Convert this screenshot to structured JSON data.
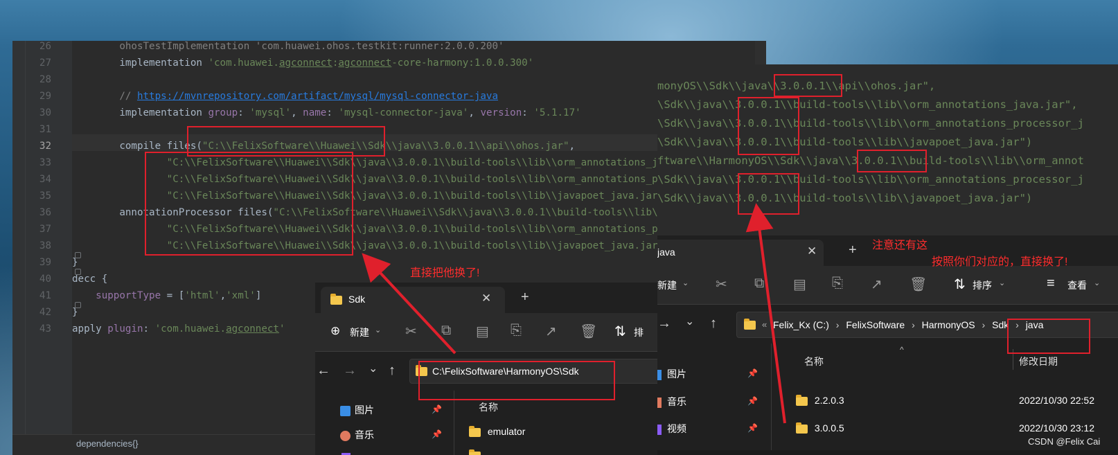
{
  "editor": {
    "lines": [
      {
        "num": "26",
        "segs": [
          {
            "t": "        ohosTestImplementation 'com.huawei.ohos.testkit:runner:2.0.0.200'",
            "c": "cmt"
          }
        ]
      },
      {
        "num": "27",
        "segs": [
          {
            "t": "        implementation ",
            "c": ""
          },
          {
            "t": "'com.huawei.",
            "c": "str"
          },
          {
            "t": "agconnect",
            "c": "str ul"
          },
          {
            "t": ":",
            "c": "str"
          },
          {
            "t": "agconnect",
            "c": "str ul"
          },
          {
            "t": "-core-harmony:1.0.0.300'",
            "c": "str"
          }
        ]
      },
      {
        "num": "28",
        "segs": []
      },
      {
        "num": "29",
        "segs": [
          {
            "t": "        // ",
            "c": "cmt"
          },
          {
            "t": "https://mvnrepository.com/artifact/mysql/mysql-connector-java",
            "c": "url"
          }
        ]
      },
      {
        "num": "30",
        "segs": [
          {
            "t": "        implementation ",
            "c": ""
          },
          {
            "t": "group",
            "c": "nm"
          },
          {
            "t": ": ",
            "c": ""
          },
          {
            "t": "'mysql'",
            "c": "str"
          },
          {
            "t": ", ",
            "c": ""
          },
          {
            "t": "name",
            "c": "nm"
          },
          {
            "t": ": ",
            "c": ""
          },
          {
            "t": "'mysql-connector-java'",
            "c": "str"
          },
          {
            "t": ", ",
            "c": ""
          },
          {
            "t": "version",
            "c": "nm"
          },
          {
            "t": ": ",
            "c": ""
          },
          {
            "t": "'5.1.17'",
            "c": "str"
          }
        ]
      },
      {
        "num": "31",
        "segs": []
      },
      {
        "num": "32",
        "cur": true,
        "segs": [
          {
            "t": "        compile files(",
            "c": ""
          },
          {
            "t": "\"C:\\\\FelixSoftware\\\\Huawei\\\\Sdk\\\\java\\\\3.0.0.1\\\\api\\\\ohos.jar\"",
            "c": "str"
          },
          {
            "t": ",",
            "c": ""
          }
        ]
      },
      {
        "num": "33",
        "segs": [
          {
            "t": "                \"C:\\\\FelixSoftware\\\\Huawei\\\\Sdk\\\\java\\\\3.0.0.1\\\\build-tools\\\\lib\\\\orm_annotations_java.jar\",",
            "c": "str"
          }
        ]
      },
      {
        "num": "34",
        "segs": [
          {
            "t": "                \"C:\\\\FelixSoftware\\\\Huawei\\\\Sdk\\\\java\\\\3.0.0.1\\\\build-tools\\\\lib\\\\orm_annotations_processor_java.jar\",",
            "c": "str"
          }
        ]
      },
      {
        "num": "35",
        "segs": [
          {
            "t": "                \"C:\\\\FelixSoftware\\\\Huawei\\\\Sdk\\\\java\\\\3.0.0.1\\\\build-tools\\\\lib\\\\javapoet_java.jar\")",
            "c": "str"
          }
        ]
      },
      {
        "num": "36",
        "segs": [
          {
            "t": "        annotationProcessor files(",
            "c": ""
          },
          {
            "t": "\"C:\\\\FelixSoftware\\\\Huawei\\\\Sdk\\\\java\\\\3.0.0.1\\\\build-tools\\\\lib\\\\orm_annotations_java.jar\",",
            "c": "str"
          }
        ]
      },
      {
        "num": "37",
        "segs": [
          {
            "t": "                \"C:\\\\FelixSoftware\\\\Huawei\\\\Sdk\\\\java\\\\3.0.0.1\\\\build-tools\\\\lib\\\\orm_annotations_processor_java.jar\",",
            "c": "str"
          }
        ]
      },
      {
        "num": "38",
        "segs": [
          {
            "t": "                \"C:\\\\FelixSoftware\\\\Huawei\\\\Sdk\\\\java\\\\3.0.0.1\\\\build-tools\\\\lib\\\\javapoet_java.jar\")",
            "c": "str"
          }
        ]
      },
      {
        "num": "39",
        "segs": [
          {
            "t": "}",
            "c": ""
          }
        ]
      },
      {
        "num": "40",
        "segs": [
          {
            "t": "decc {",
            "c": ""
          }
        ]
      },
      {
        "num": "41",
        "segs": [
          {
            "t": "    ",
            "c": ""
          },
          {
            "t": "supportType",
            "c": "nm"
          },
          {
            "t": " = [",
            "c": ""
          },
          {
            "t": "'html'",
            "c": "str"
          },
          {
            "t": ",",
            "c": ""
          },
          {
            "t": "'xml'",
            "c": "str"
          },
          {
            "t": "]",
            "c": ""
          }
        ]
      },
      {
        "num": "42",
        "segs": [
          {
            "t": "}",
            "c": ""
          }
        ]
      },
      {
        "num": "43",
        "segs": [
          {
            "t": "apply ",
            "c": ""
          },
          {
            "t": "plugin",
            "c": "nm"
          },
          {
            "t": ": ",
            "c": ""
          },
          {
            "t": "'com.huawei.",
            "c": "str"
          },
          {
            "t": "agconnect",
            "c": "str ul"
          },
          {
            "t": "'",
            "c": "str"
          }
        ]
      }
    ],
    "footer": "dependencies{}"
  },
  "zoom": {
    "lines": [
      "monyOS\\\\Sdk\\\\java\\\\3.0.0.1\\\\api\\\\ohos.jar\",",
      "\\Sdk\\\\java\\\\3.0.0.1\\\\build-tools\\\\lib\\\\orm_annotations_java.jar\",",
      "\\Sdk\\\\java\\\\3.0.0.1\\\\build-tools\\\\lib\\\\orm_annotations_processor_j",
      "\\Sdk\\\\java\\\\3.0.0.1\\\\build-tools\\\\lib\\\\javapoet_java.jar\")",
      "ftware\\\\HarmonyOS\\\\Sdk\\\\java\\\\3.0.0.1\\\\build-tools\\\\lib\\\\orm_annot",
      "\\Sdk\\\\java\\\\3.0.0.1\\\\build-tools\\\\lib\\\\orm_annotations_processor_j",
      "\\Sdk\\\\java\\\\3.0.0.1\\\\build-tools\\\\lib\\\\javapoet_java.jar\")"
    ]
  },
  "annotations": {
    "replace_note": "直接把他换了!",
    "also_note": "注意还有这",
    "match_note": "按照你们对应的，直接换了!"
  },
  "explorer_left": {
    "tab_title": "Sdk",
    "new_label": "新建",
    "sort_partial": "排",
    "address": "C:\\FelixSoftware\\HarmonyOS\\Sdk",
    "sidebar": [
      {
        "label": "图片",
        "icon": "pictures-icon"
      },
      {
        "label": "音乐",
        "icon": "music-icon"
      }
    ],
    "column_name": "名称",
    "rows": [
      "emulator"
    ]
  },
  "explorer_right": {
    "tab_title": "java",
    "new_label": "新建",
    "sort_label": "排序",
    "view_label": "查看",
    "breadcrumb": [
      "Felix_Kx (C:)",
      "FelixSoftware",
      "HarmonyOS",
      "Sdk",
      "java"
    ],
    "sidebar": [
      {
        "label": "图片",
        "icon": "pictures-icon"
      },
      {
        "label": "音乐",
        "icon": "music-icon"
      },
      {
        "label": "视频",
        "icon": "videos-icon"
      }
    ],
    "column_name": "名称",
    "column_date": "修改日期",
    "rows": [
      {
        "name": "2.2.0.3",
        "date": "2022/10/30 22:52"
      },
      {
        "name": "3.0.0.5",
        "date": "2022/10/30 23:12"
      }
    ]
  },
  "watermark": "CSDN @Felix Cai",
  "colors": {
    "annotation_red": "#e0202c",
    "folder_yellow": "#f4c74d",
    "code_string": "#6a8759",
    "code_keyword_name": "#9876aa"
  }
}
